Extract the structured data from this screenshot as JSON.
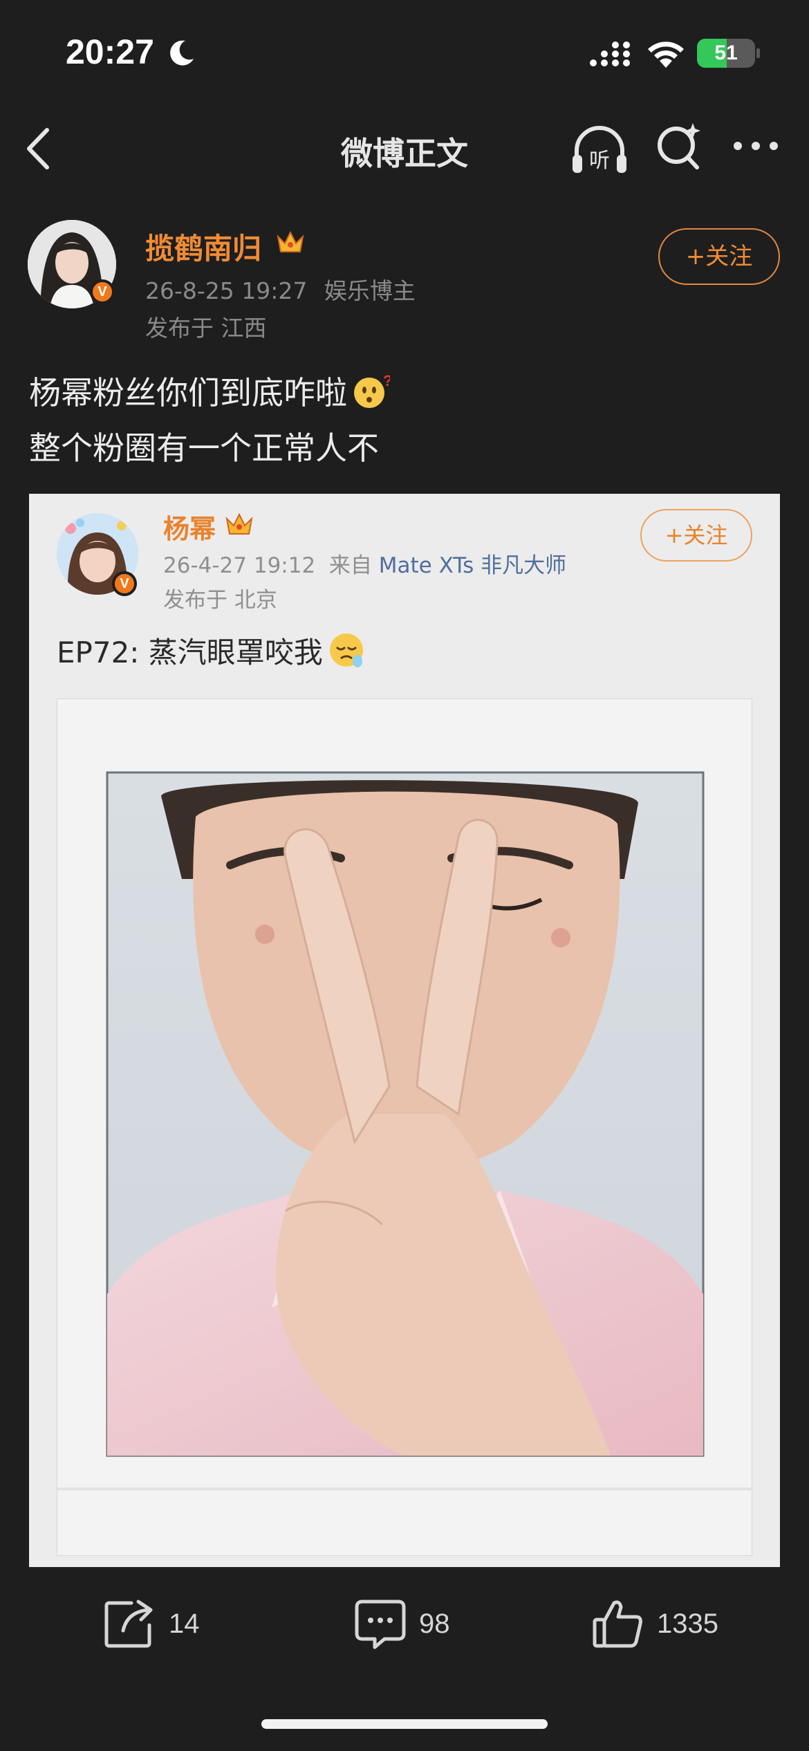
{
  "status_bar": {
    "time": "20:27",
    "battery_level": "51",
    "battery_fraction": 0.51
  },
  "nav": {
    "title": "微博正文",
    "listen_label": "听"
  },
  "post": {
    "author_name": "揽鹤南归",
    "date": "26-8-25 19:27",
    "author_tag": "娱乐博主",
    "location": "发布于 江西",
    "follow_label": "+关注",
    "text_line1": "杨幂粉丝你们到底咋啦",
    "text_line2": "整个粉圈有一个正常人不",
    "verify_mark": "V"
  },
  "embed": {
    "author_name": "杨幂",
    "date": "26-4-27 19:12",
    "source_prefix": "来自",
    "device": "Mate XTs 非凡大师",
    "location": "发布于 北京",
    "follow_label": "+关注",
    "text": "EP72: 蒸汽眼罩咬我",
    "verify_mark": "V"
  },
  "toolbar": {
    "reposts": "14",
    "comments": "98",
    "likes": "1335"
  },
  "colors": {
    "accent": "#f08b36",
    "background": "#1e1e1e",
    "embed_bg": "#ececec",
    "battery_green": "#34c759"
  }
}
